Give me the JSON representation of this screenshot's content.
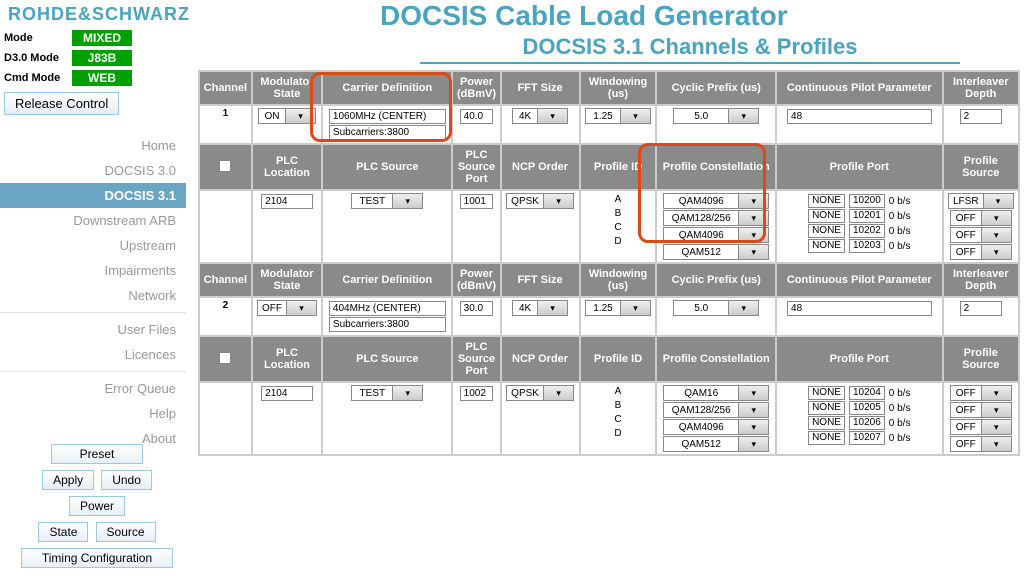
{
  "brand": "ROHDE&SCHWARZ",
  "title": "DOCSIS Cable Load Generator",
  "subtitle": "DOCSIS 3.1 Channels & Profiles",
  "modes": {
    "mode_lbl": "Mode",
    "mode_val": "MIXED",
    "d3_lbl": "D3.0 Mode",
    "d3_val": "J83B",
    "cmd_lbl": "Cmd Mode",
    "cmd_val": "WEB"
  },
  "release_btn": "Release Control",
  "nav": [
    "Home",
    "DOCSIS 3.0",
    "DOCSIS 3.1",
    "Downstream ARB",
    "Upstream",
    "Impairments",
    "Network",
    "User Files",
    "Licences",
    "Error Queue",
    "Help",
    "About"
  ],
  "nav_active": 2,
  "bottom_btns": {
    "preset": "Preset",
    "apply": "Apply",
    "undo": "Undo",
    "power": "Power",
    "state": "State",
    "source": "Source",
    "timing": "Timing Configuration"
  },
  "headers": {
    "channel": "Channel",
    "modstate": "Modulator State",
    "carrier": "Carrier Definition",
    "power": "Power (dBmV)",
    "fft": "FFT Size",
    "windowing": "Windowing (us)",
    "cyclic": "Cyclic Prefix (us)",
    "pilot": "Continuous Pilot Parameter",
    "interleaver": "Interleaver Depth",
    "plc_loc": "PLC Location",
    "plc_src": "PLC Source",
    "plc_port": "PLC Source Port",
    "ncp": "NCP Order",
    "profile_id": "Profile ID",
    "profile_const": "Profile Constellation",
    "profile_port": "Profile Port",
    "profile_source": "Profile Source"
  },
  "channels": [
    {
      "num": "1",
      "modstate": "ON",
      "carrier_center": "1060MHz (CENTER)",
      "carrier_sub": "Subcarriers:3800",
      "power": "40.0",
      "fft": "4K",
      "windowing": "1.25",
      "cyclic": "5.0",
      "pilot": "48",
      "interleaver": "2",
      "plc_loc": "2104",
      "plc_src": "TEST",
      "plc_port": "1001",
      "ncp": "QPSK",
      "profiles": [
        "A",
        "B",
        "C",
        "D"
      ],
      "constellations": [
        "QAM4096",
        "QAM128/256",
        "QAM4096",
        "QAM512"
      ],
      "port_rows": [
        {
          "a": "NONE",
          "b": "10200",
          "c": "0 b/s"
        },
        {
          "a": "NONE",
          "b": "10201",
          "c": "0 b/s"
        },
        {
          "a": "NONE",
          "b": "10202",
          "c": "0 b/s"
        },
        {
          "a": "NONE",
          "b": "10203",
          "c": "0 b/s"
        }
      ],
      "sources": [
        "LFSR",
        "OFF",
        "OFF",
        "OFF"
      ]
    },
    {
      "num": "2",
      "modstate": "OFF",
      "carrier_center": "404MHz (CENTER)",
      "carrier_sub": "Subcarriers:3800",
      "power": "30.0",
      "fft": "4K",
      "windowing": "1.25",
      "cyclic": "5.0",
      "pilot": "48",
      "interleaver": "2",
      "plc_loc": "2104",
      "plc_src": "TEST",
      "plc_port": "1002",
      "ncp": "QPSK",
      "profiles": [
        "A",
        "B",
        "C",
        "D"
      ],
      "constellations": [
        "QAM16",
        "QAM128/256",
        "QAM4096",
        "QAM512"
      ],
      "port_rows": [
        {
          "a": "NONE",
          "b": "10204",
          "c": "0 b/s"
        },
        {
          "a": "NONE",
          "b": "10205",
          "c": "0 b/s"
        },
        {
          "a": "NONE",
          "b": "10206",
          "c": "0 b/s"
        },
        {
          "a": "NONE",
          "b": "10207",
          "c": "0 b/s"
        }
      ],
      "sources": [
        "OFF",
        "OFF",
        "OFF",
        "OFF"
      ]
    }
  ]
}
